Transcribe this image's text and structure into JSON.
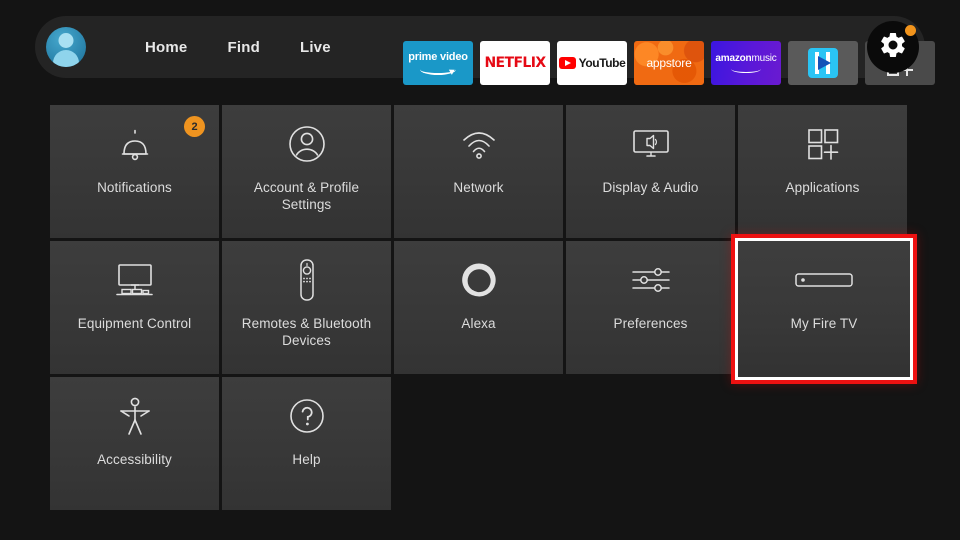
{
  "header": {
    "avatar": {
      "name": "profile-avatar"
    },
    "nav": [
      {
        "label": "Home",
        "name": "nav-home"
      },
      {
        "label": "Find",
        "name": "nav-find"
      },
      {
        "label": "Live",
        "name": "nav-live"
      }
    ],
    "apps": [
      {
        "name": "prime-video",
        "line1": "prime video"
      },
      {
        "name": "netflix",
        "line1": "NETFLIX"
      },
      {
        "name": "youtube",
        "line1": "YouTube"
      },
      {
        "name": "appstore",
        "line1": "appstore"
      },
      {
        "name": "amazon-music",
        "line1": "amazon",
        "line2": "music"
      },
      {
        "name": "blue-media-app",
        "line1": ""
      },
      {
        "name": "app-library-grid",
        "line1": ""
      }
    ],
    "settings_button": {
      "label": "Settings",
      "icon": "gear-icon",
      "badge_color": "#f2941c",
      "has_badge": true
    }
  },
  "grid": {
    "tiles": [
      {
        "label": "Notifications",
        "icon": "bell-icon",
        "badge": "2"
      },
      {
        "label": "Account & Profile Settings",
        "icon": "person-circle-icon",
        "badge": null
      },
      {
        "label": "Network",
        "icon": "wifi-icon",
        "badge": null
      },
      {
        "label": "Display & Audio",
        "icon": "tv-speaker-icon",
        "badge": null
      },
      {
        "label": "Applications",
        "icon": "apps-grid-plus-icon",
        "badge": null
      },
      {
        "label": "Equipment Control",
        "icon": "tv-soundbar-icon",
        "badge": null
      },
      {
        "label": "Remotes & Bluetooth Devices",
        "icon": "remote-control-icon",
        "badge": null
      },
      {
        "label": "Alexa",
        "icon": "alexa-ring-icon",
        "badge": null
      },
      {
        "label": "Preferences",
        "icon": "sliders-icon",
        "badge": null
      },
      {
        "label": "My Fire TV",
        "icon": "fire-tv-stick-icon",
        "badge": null,
        "selected": true
      },
      {
        "label": "Accessibility",
        "icon": "accessibility-person-icon",
        "badge": null
      },
      {
        "label": "Help",
        "icon": "question-circle-icon",
        "badge": null
      }
    ]
  },
  "colors": {
    "page_background": "#141414",
    "tile_background": "#3a3a3a",
    "header_background": "#242424",
    "selection_red": "#ee1111",
    "badge_orange": "#ef9420",
    "text_primary": "#dcdcdc"
  }
}
